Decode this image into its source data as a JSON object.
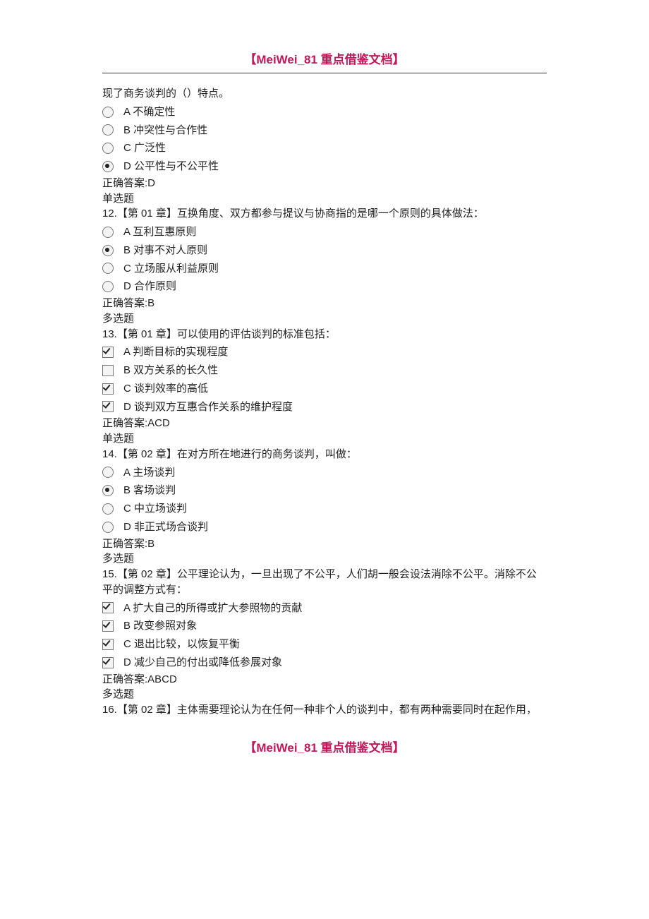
{
  "header": "【MeiWei_81 重点借鉴文档】",
  "footer": "【MeiWei_81 重点借鉴文档】",
  "q11": {
    "stem": "现了商务谈判的（）特点。",
    "options": [
      {
        "label": "A 不确定性",
        "selected": false
      },
      {
        "label": "B 冲突性与合作性",
        "selected": false
      },
      {
        "label": "C 广泛性",
        "selected": false
      },
      {
        "label": "D 公平性与不公平性",
        "selected": true
      }
    ],
    "answer": "正确答案:D"
  },
  "q12": {
    "type": "单选题",
    "stem": "12.【第 01 章】互换角度、双方都参与提议与协商指的是哪一个原则的具体做法：",
    "options": [
      {
        "label": "A 互利互惠原则",
        "selected": false
      },
      {
        "label": "B 对事不对人原则",
        "selected": true
      },
      {
        "label": "C 立场服从利益原则",
        "selected": false
      },
      {
        "label": "D 合作原则",
        "selected": false
      }
    ],
    "answer": "正确答案:B"
  },
  "q13": {
    "type": "多选题",
    "stem": "13.【第 01 章】可以使用的评估谈判的标准包括：",
    "options": [
      {
        "label": "A 判断目标的实现程度",
        "selected": true
      },
      {
        "label": "B 双方关系的长久性",
        "selected": false
      },
      {
        "label": "C 谈判效率的高低",
        "selected": true
      },
      {
        "label": "D 谈判双方互惠合作关系的维护程度",
        "selected": true
      }
    ],
    "answer": "正确答案:ACD"
  },
  "q14": {
    "type": "单选题",
    "stem": "14.【第 02 章】在对方所在地进行的商务谈判，叫做：",
    "options": [
      {
        "label": "A 主场谈判",
        "selected": false
      },
      {
        "label": "B 客场谈判",
        "selected": true
      },
      {
        "label": "C 中立场谈判",
        "selected": false
      },
      {
        "label": "D 非正式场合谈判",
        "selected": false
      }
    ],
    "answer": "正确答案:B"
  },
  "q15": {
    "type": "多选题",
    "stem": "15.【第 02 章】公平理论认为，一旦出现了不公平，人们胡一般会设法消除不公平。消除不公平的调整方式有：",
    "options": [
      {
        "label": "A 扩大自己的所得或扩大参照物的贡献",
        "selected": true
      },
      {
        "label": "B 改变参照对象",
        "selected": true
      },
      {
        "label": "C 退出比较，以恢复平衡",
        "selected": true
      },
      {
        "label": "D 减少自己的付出或降低参展对象",
        "selected": true
      }
    ],
    "answer": "正确答案:ABCD"
  },
  "q16": {
    "type": "多选题",
    "stem": "16.【第 02 章】主体需要理论认为在任何一种非个人的谈判中，都有两种需要同时在起作用，"
  }
}
